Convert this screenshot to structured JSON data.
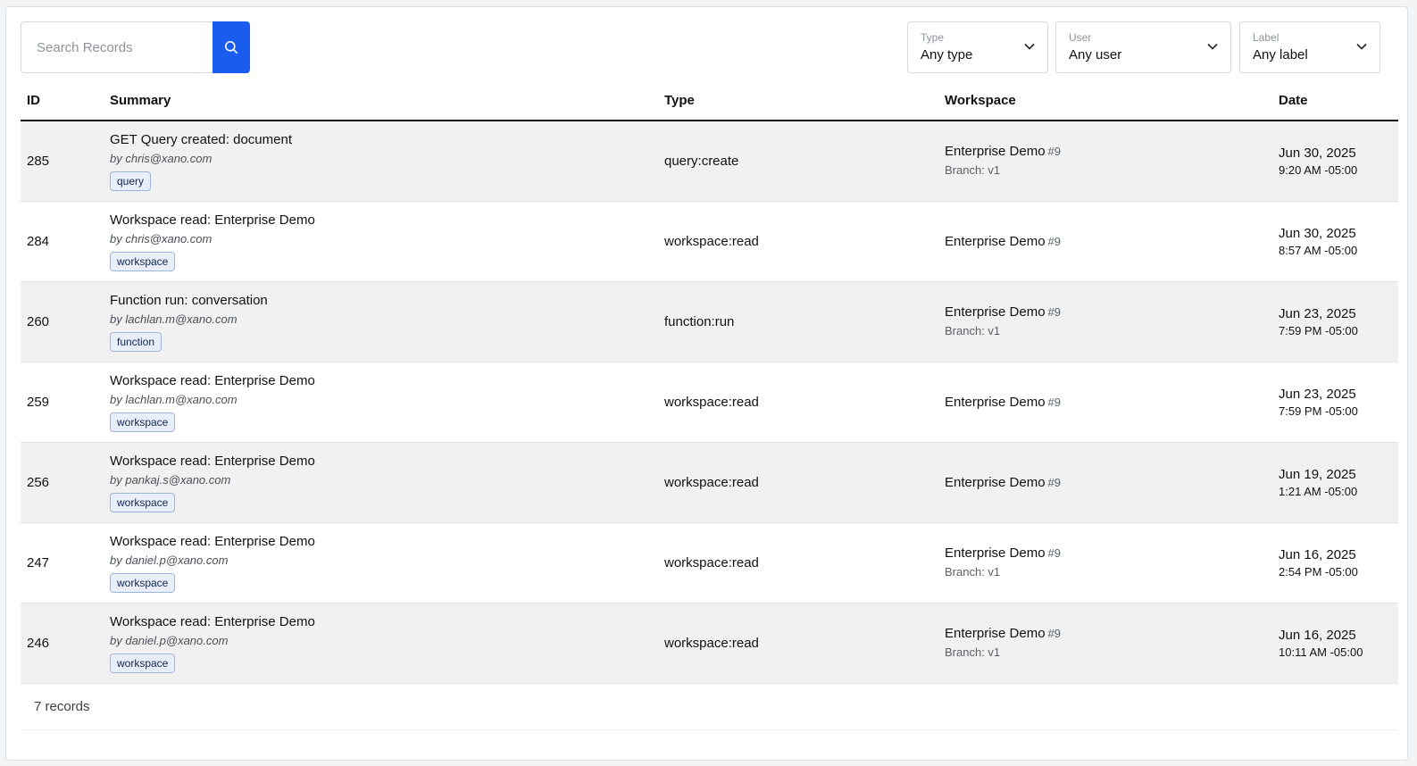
{
  "search": {
    "placeholder": "Search Records"
  },
  "filters": {
    "type": {
      "label": "Type",
      "value": "Any type"
    },
    "user": {
      "label": "User",
      "value": "Any user"
    },
    "label": {
      "label": "Label",
      "value": "Any label"
    }
  },
  "table": {
    "headers": {
      "id": "ID",
      "summary": "Summary",
      "type": "Type",
      "workspace": "Workspace",
      "date": "Date"
    },
    "rows": [
      {
        "id": "285",
        "title": "GET Query created: document",
        "by": "by chris@xano.com",
        "tag": "query",
        "type": "query:create",
        "workspace": "Enterprise Demo",
        "ws_num": "#9",
        "branch": "Branch: v1",
        "date": "Jun 30, 2025",
        "time": "9:20 AM -05:00"
      },
      {
        "id": "284",
        "title": "Workspace read: Enterprise Demo",
        "by": "by chris@xano.com",
        "tag": "workspace",
        "type": "workspace:read",
        "workspace": "Enterprise Demo",
        "ws_num": "#9",
        "branch": "",
        "date": "Jun 30, 2025",
        "time": "8:57 AM -05:00"
      },
      {
        "id": "260",
        "title": "Function run: conversation",
        "by": "by lachlan.m@xano.com",
        "tag": "function",
        "type": "function:run",
        "workspace": "Enterprise Demo",
        "ws_num": "#9",
        "branch": "Branch: v1",
        "date": "Jun 23, 2025",
        "time": "7:59 PM -05:00"
      },
      {
        "id": "259",
        "title": "Workspace read: Enterprise Demo",
        "by": "by lachlan.m@xano.com",
        "tag": "workspace",
        "type": "workspace:read",
        "workspace": "Enterprise Demo",
        "ws_num": "#9",
        "branch": "",
        "date": "Jun 23, 2025",
        "time": "7:59 PM -05:00"
      },
      {
        "id": "256",
        "title": "Workspace read: Enterprise Demo",
        "by": "by pankaj.s@xano.com",
        "tag": "workspace",
        "type": "workspace:read",
        "workspace": "Enterprise Demo",
        "ws_num": "#9",
        "branch": "",
        "date": "Jun 19, 2025",
        "time": "1:21 AM -05:00"
      },
      {
        "id": "247",
        "title": "Workspace read: Enterprise Demo",
        "by": "by daniel.p@xano.com",
        "tag": "workspace",
        "type": "workspace:read",
        "workspace": "Enterprise Demo",
        "ws_num": "#9",
        "branch": "Branch: v1",
        "date": "Jun 16, 2025",
        "time": "2:54 PM -05:00"
      },
      {
        "id": "246",
        "title": "Workspace read: Enterprise Demo",
        "by": "by daniel.p@xano.com",
        "tag": "workspace",
        "type": "workspace:read",
        "workspace": "Enterprise Demo",
        "ws_num": "#9",
        "branch": "Branch: v1",
        "date": "Jun 16, 2025",
        "time": "10:11 AM -05:00"
      }
    ]
  },
  "footer": {
    "count": "7 records"
  },
  "icons": {
    "search": "search-icon",
    "chevron": "chevron-down-icon"
  },
  "colors": {
    "accent": "#1a5cf0",
    "row_alt": "#f1f1f2",
    "tag_bg": "#e9effa",
    "tag_border": "#9fb4d9"
  }
}
